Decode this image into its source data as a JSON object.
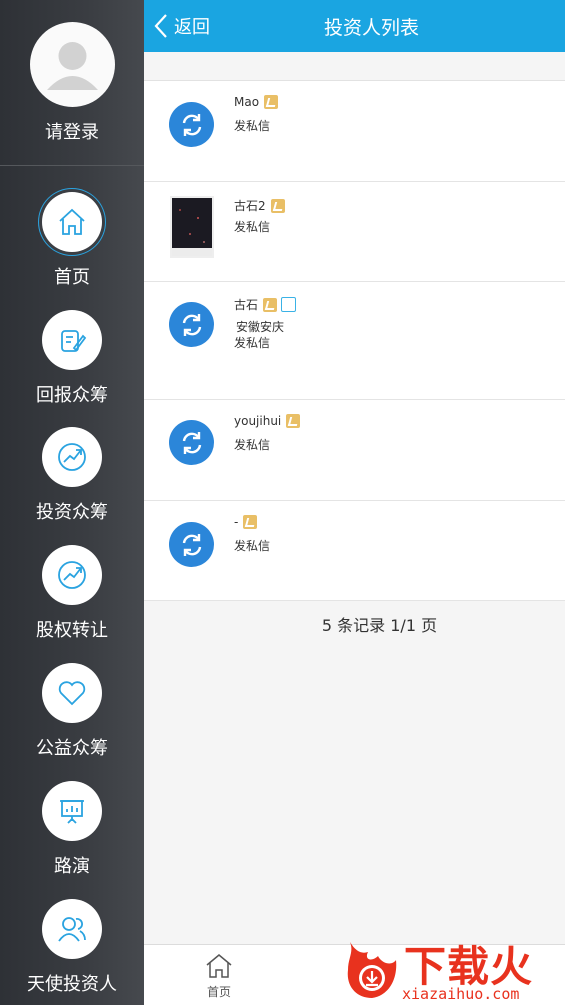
{
  "sidebar": {
    "login_label": "请登录",
    "items": [
      {
        "label": "首页",
        "icon": "home-icon"
      },
      {
        "label": "回报众筹",
        "icon": "pen-icon"
      },
      {
        "label": "投资众筹",
        "icon": "growth-chart-icon"
      },
      {
        "label": "股权转让",
        "icon": "growth-chart-icon"
      },
      {
        "label": "公益众筹",
        "icon": "heart-icon"
      },
      {
        "label": "路演",
        "icon": "presentation-icon"
      },
      {
        "label": "天使投资人",
        "icon": "users-icon"
      }
    ]
  },
  "header": {
    "back_label": "返回",
    "title": "投资人列表"
  },
  "investors": [
    {
      "name": "Mao",
      "message_label": "发私信"
    },
    {
      "name": "古石2",
      "message_label": "发私信"
    },
    {
      "name": "古石",
      "location": "安徽安庆",
      "message_label": "发私信"
    },
    {
      "name": "youjihui",
      "message_label": "发私信"
    },
    {
      "name": "-",
      "message_label": "发私信"
    }
  ],
  "pagination": {
    "text": "5 条记录 1/1 页"
  },
  "bottom_bar": {
    "home_label": "首页"
  },
  "watermark": {
    "brand": "下载火",
    "url": "xiazaihuo.com"
  },
  "colors": {
    "header": "#1aa5e1",
    "sidebar": "#3a3d42",
    "avatar_blue": "#2b86d9",
    "vip_gold": "#e9bf66",
    "watermark_red": "#e8321e"
  }
}
